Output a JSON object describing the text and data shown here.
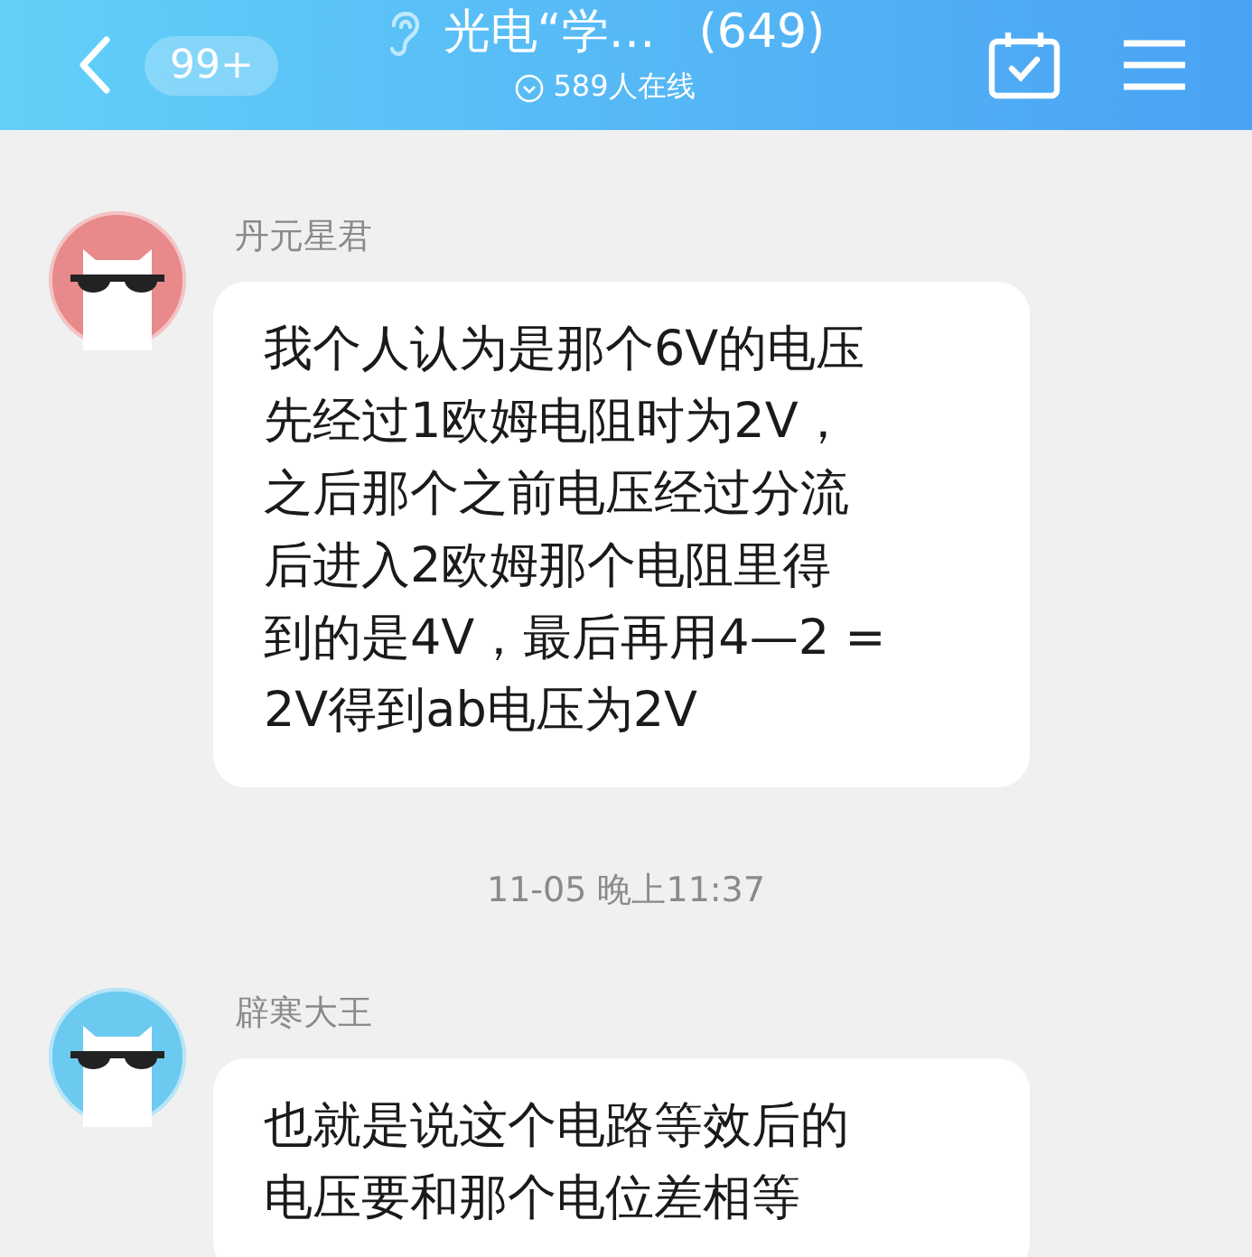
{
  "header": {
    "back_badge": "99+",
    "title": "光电“学…",
    "member_count": "(649)",
    "online": "589人在线"
  },
  "messages": [
    {
      "kind": "message",
      "sender": "丹元星君",
      "color": "#e8898b",
      "lines": [
        "我个人认为是那个6V的电压",
        "先经过1欧姆电阻时为2V，",
        "之后那个之前电压经过分流",
        "后进入2欧姆那个电阻里得",
        "到的是4V，最后再用4—2 =",
        "2V得到ab电压为2V"
      ]
    },
    {
      "kind": "time",
      "text": "11-05 晚上11:37"
    },
    {
      "kind": "message",
      "sender": "辟寒大王",
      "color": "#6ccaf0",
      "lines": [
        "也就是说这个电路等效后的",
        "电压要和那个电位差相等"
      ]
    }
  ]
}
